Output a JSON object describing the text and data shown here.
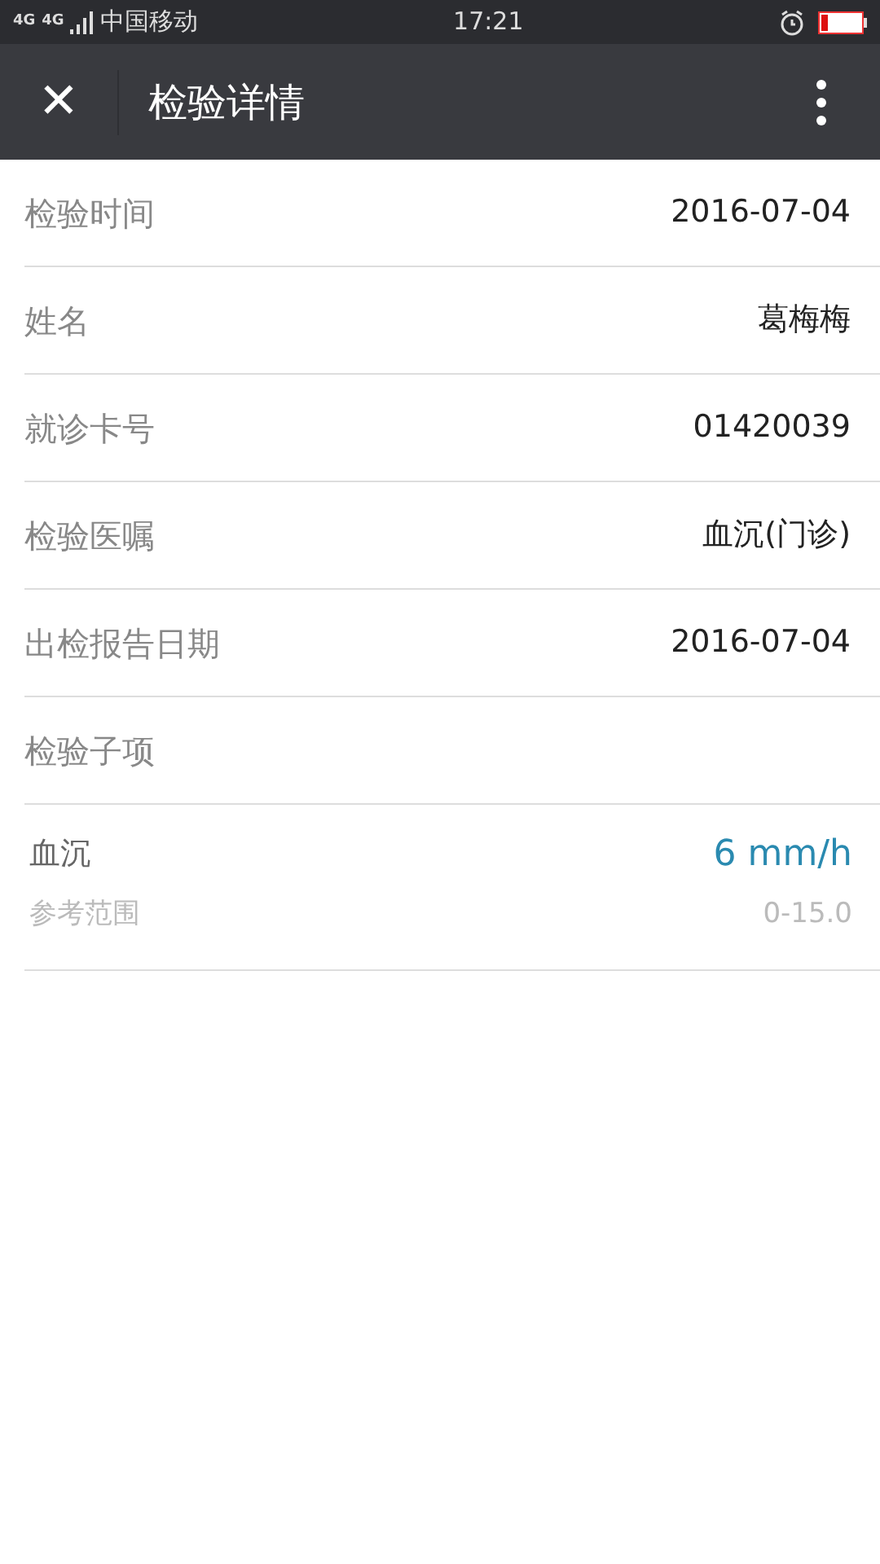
{
  "status_bar": {
    "network": "4G",
    "network_2": "4G",
    "carrier": "中国移动",
    "time": "17:21"
  },
  "header": {
    "close": "✕",
    "title": "检验详情"
  },
  "fields": [
    {
      "label": "检验时间",
      "value": "2016-07-04"
    },
    {
      "label": "姓名",
      "value": "葛梅梅"
    },
    {
      "label": "就诊卡号",
      "value": "01420039"
    },
    {
      "label": "检验医嘱",
      "value": "血沉(门诊)"
    },
    {
      "label": "出检报告日期",
      "value": "2016-07-04"
    },
    {
      "label": "检验子项"
    }
  ],
  "sub_items": [
    {
      "name": "血沉",
      "result": "6 mm/h",
      "range_label": "参考范围",
      "range": "0-15.0"
    }
  ]
}
